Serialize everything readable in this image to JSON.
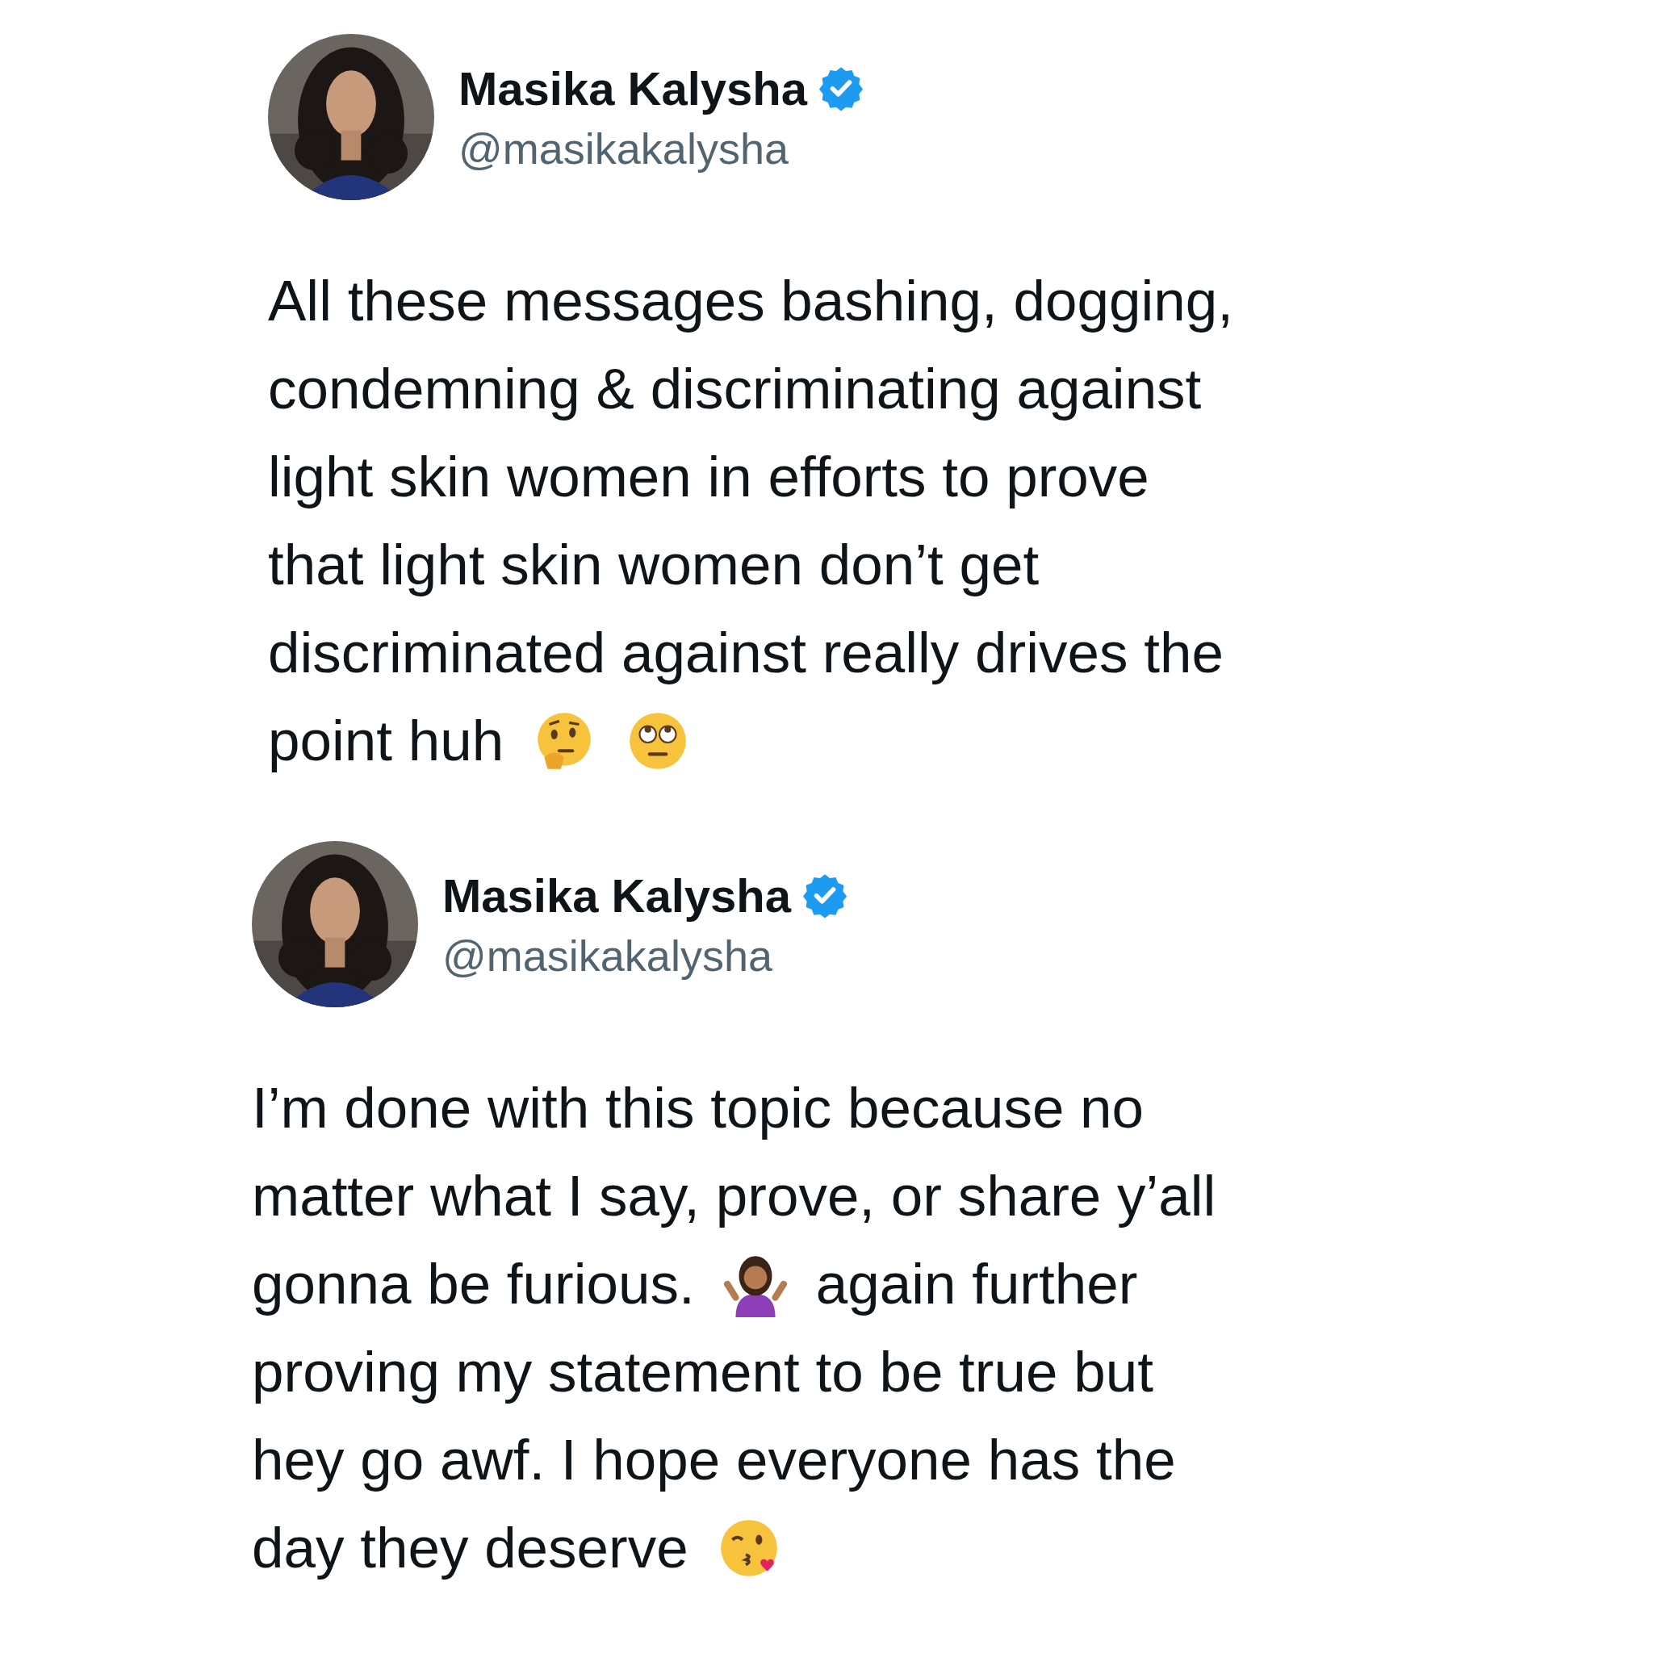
{
  "tweets": [
    {
      "author": {
        "name": "Masika Kalysha",
        "verified": true,
        "handle": "@masikakalysha"
      },
      "lines": [
        [
          {
            "kind": "text",
            "text": "All these messages bashing, dogging,"
          }
        ],
        [
          {
            "kind": "text",
            "text": "condemning & discriminating against"
          }
        ],
        [
          {
            "kind": "text",
            "text": "light skin women in efforts to prove"
          }
        ],
        [
          {
            "kind": "text",
            "text": "that light skin women don’t get"
          }
        ],
        [
          {
            "kind": "text",
            "text": "discriminated against really drives the"
          }
        ],
        [
          {
            "kind": "text",
            "text": "point huh"
          },
          {
            "kind": "thinking"
          },
          {
            "kind": "eyeroll"
          }
        ]
      ]
    },
    {
      "author": {
        "name": "Masika Kalysha",
        "verified": true,
        "handle": "@masikakalysha"
      },
      "lines": [
        [
          {
            "kind": "text",
            "text": "I’m done with this topic because no"
          }
        ],
        [
          {
            "kind": "text",
            "text": "matter what I say, prove, or share y’all"
          }
        ],
        [
          {
            "kind": "text",
            "text": "gonna be furious."
          },
          {
            "kind": "shrug"
          },
          {
            "kind": "text",
            "text": "again further"
          }
        ],
        [
          {
            "kind": "text",
            "text": "proving my statement to be true but"
          }
        ],
        [
          {
            "kind": "text",
            "text": "hey go awf. I hope everyone has the"
          }
        ],
        [
          {
            "kind": "text",
            "text": "day they deserve"
          },
          {
            "kind": "kiss"
          }
        ]
      ]
    }
  ]
}
